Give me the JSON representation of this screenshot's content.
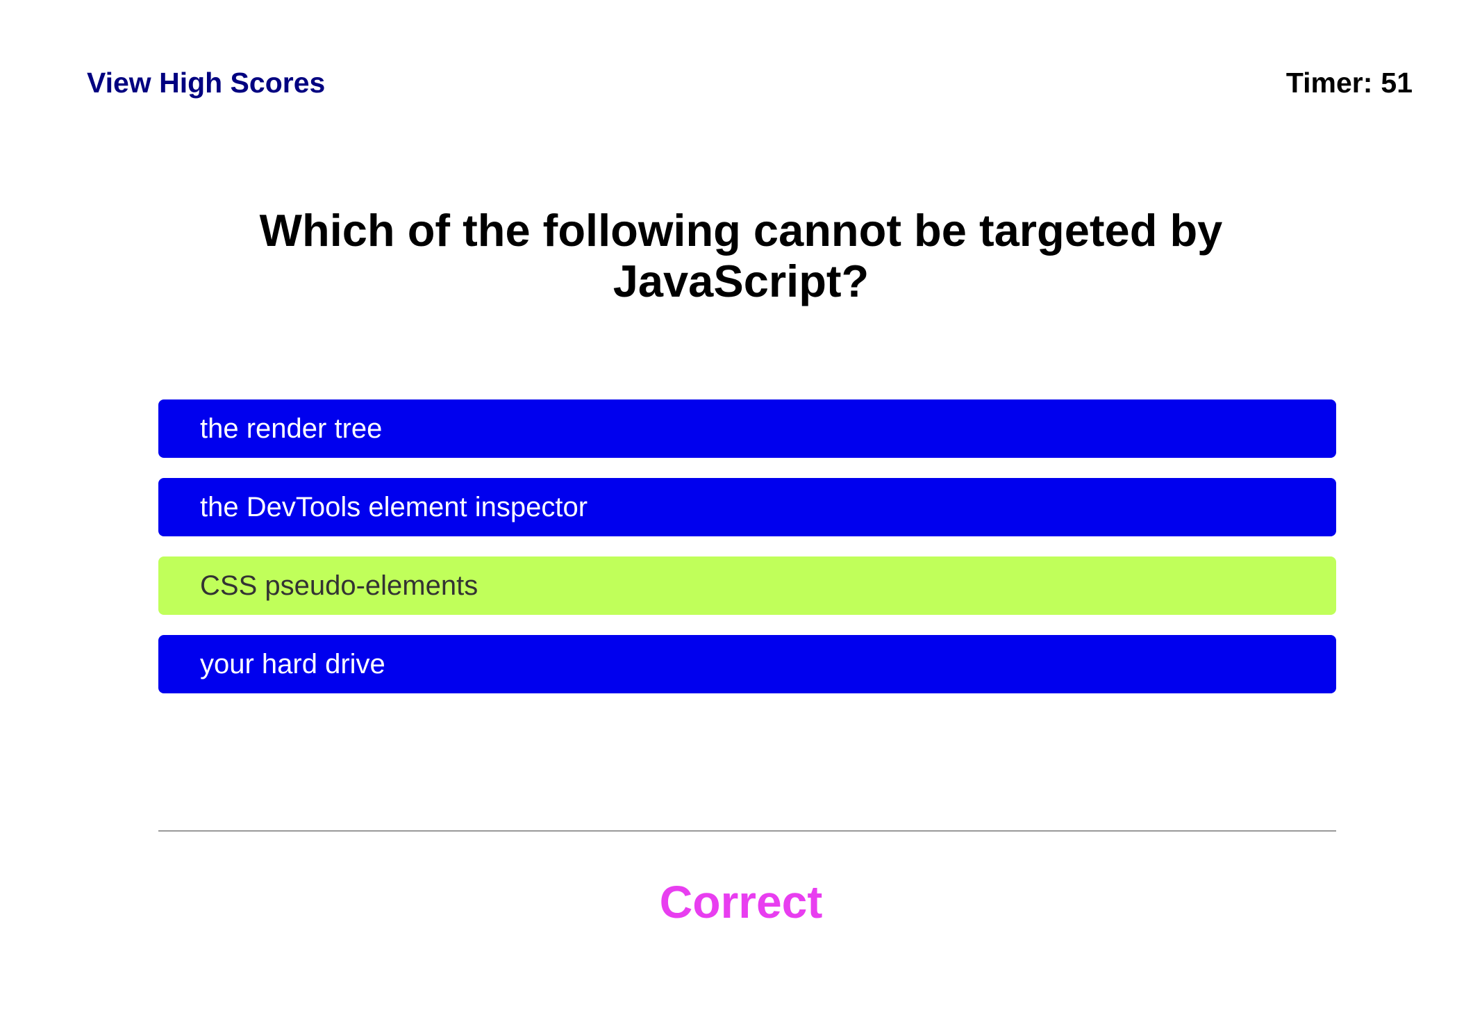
{
  "header": {
    "high_scores_label": "View High Scores",
    "timer_label": "Timer:",
    "timer_value": "51"
  },
  "question": {
    "text": "Which of the following cannot be targeted by JavaScript?"
  },
  "answers": [
    {
      "label": "the render tree",
      "state": "default"
    },
    {
      "label": "the DevTools element inspector",
      "state": "default"
    },
    {
      "label": "CSS pseudo-elements",
      "state": "correct"
    },
    {
      "label": "your hard drive",
      "state": "default"
    }
  ],
  "feedback": {
    "text": "Correct"
  },
  "colors": {
    "answer_bg": "#0000ee",
    "answer_correct_bg": "#c0ff5a",
    "link": "#000080",
    "feedback": "#e83ef0"
  }
}
